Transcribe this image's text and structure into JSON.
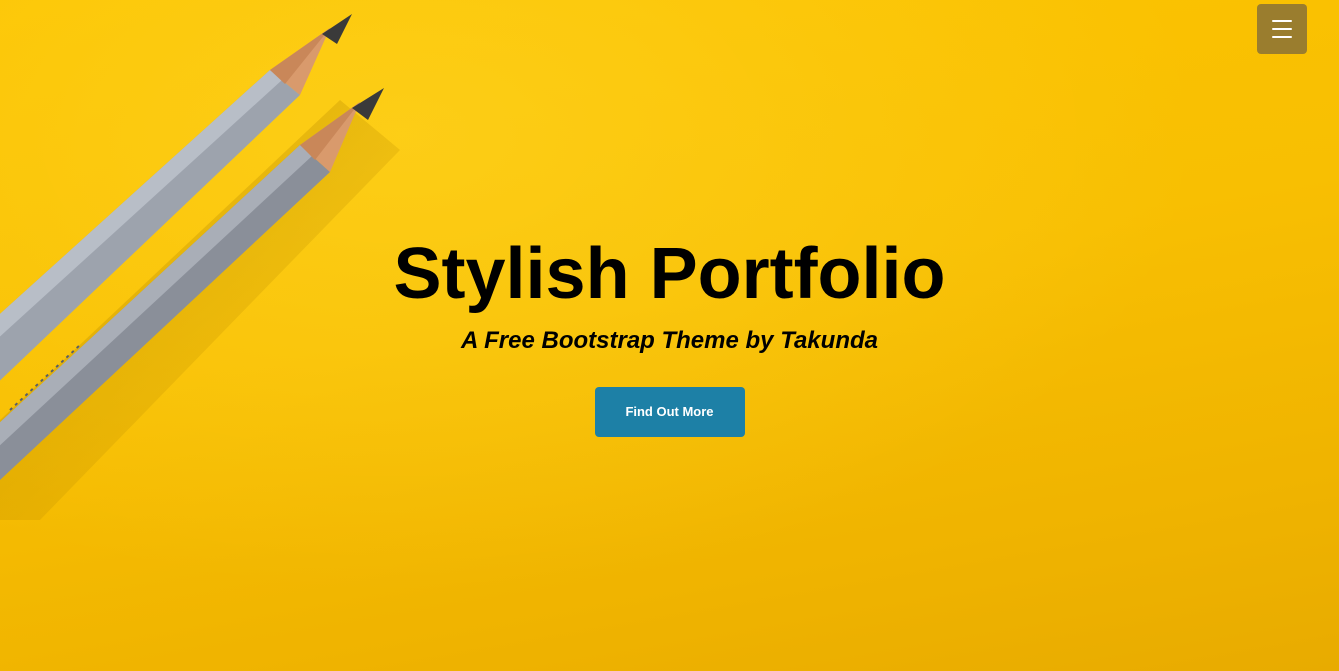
{
  "nav": {
    "menu_icon": "hamburger-icon",
    "menu_button_color": "#9a7d2e"
  },
  "hero": {
    "title": "Stylish Portfolio",
    "subtitle": "A Free Bootstrap Theme by Takunda",
    "cta_label": "Find Out More",
    "cta_color": "#1d80a6",
    "background_color": "#f8bf02"
  }
}
